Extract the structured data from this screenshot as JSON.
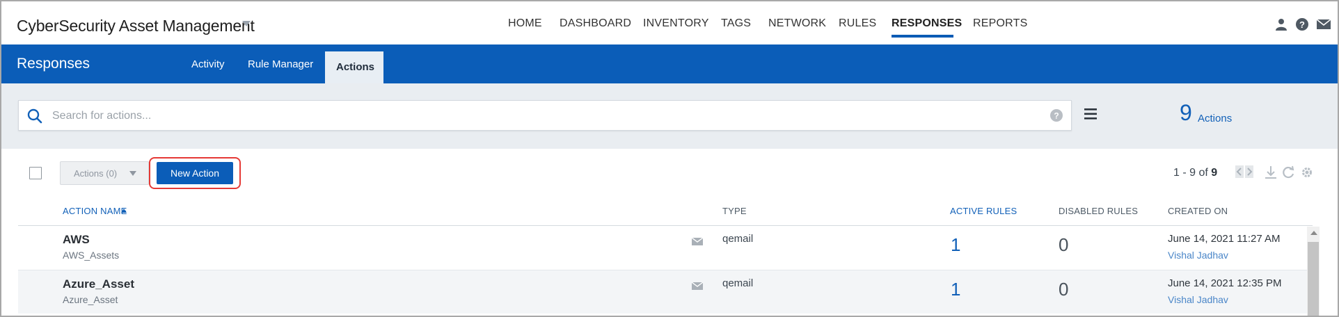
{
  "app": {
    "title": "CyberSecurity Asset Management"
  },
  "nav": {
    "items": [
      "HOME",
      "DASHBOARD",
      "INVENTORY",
      "TAGS",
      "NETWORK",
      "RULES",
      "RESPONSES",
      "REPORTS"
    ],
    "active": "RESPONSES"
  },
  "top_icons": [
    "user-icon",
    "help-icon",
    "mail-icon"
  ],
  "subnav": {
    "title": "Responses",
    "tabs": [
      "Activity",
      "Rule Manager",
      "Actions"
    ],
    "active_tab": "Actions"
  },
  "search": {
    "placeholder": "Search for actions..."
  },
  "summary": {
    "count": "9",
    "label": "Actions"
  },
  "toolbar": {
    "actions_dropdown": "Actions (0)",
    "new_action": "New Action",
    "pager_range": "1 - 9 of",
    "pager_total": "9"
  },
  "table": {
    "columns": [
      "ACTION NAME",
      "TYPE",
      "ACTIVE RULES",
      "DISABLED RULES",
      "CREATED ON"
    ],
    "sort_column": "ACTION NAME",
    "sort_direction": "ascending",
    "rows": [
      {
        "name": "AWS",
        "subtitle": "AWS_Assets",
        "type": "qemail",
        "active_rules": "1",
        "disabled_rules": "0",
        "created_on": "June 14, 2021 11:27 AM",
        "created_by": "Vishal Jadhav"
      },
      {
        "name": "Azure_Asset",
        "subtitle": "Azure_Asset",
        "type": "qemail",
        "active_rules": "1",
        "disabled_rules": "0",
        "created_on": "June 14, 2021 12:35 PM",
        "created_by": "Vishal Jadhav"
      }
    ]
  },
  "colors": {
    "brand_blue": "#0b5db8",
    "highlight_red": "#e53935",
    "link_blue": "#1160b8"
  }
}
